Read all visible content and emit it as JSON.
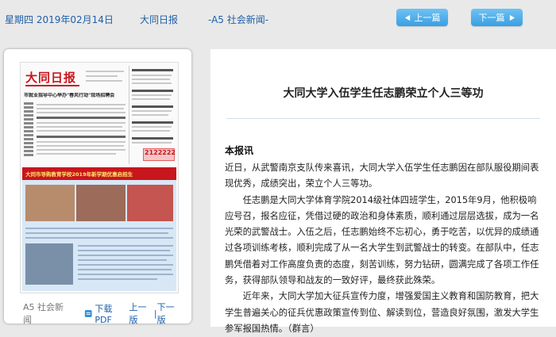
{
  "topbar": {
    "date": "星期四 2019年02月14日",
    "paper": "大同日报",
    "section": "-A5 社会新闻-",
    "prev_label": "上一篇",
    "next_label": "下一篇"
  },
  "thumbnail": {
    "masthead": "大同日报",
    "headline1": "市就业指导中心举办\"春风行动\"现场招聘会",
    "banner": "大同市导购教育学校2019年新学期优惠启招生",
    "red_number": "2122222"
  },
  "footer": {
    "section": "A5 社会新闻",
    "pdf_label": "下载PDF",
    "prev": "上一版",
    "next": "下一版",
    "separator": "|"
  },
  "article": {
    "title": "大同大学入伍学生任志鹏荣立个人三等功",
    "lead": "本报讯",
    "paragraphs": [
      "近日，从武警南京支队传来喜讯，大同大学入伍学生任志鹏因在部队服役期间表现优秀，成绩突出，荣立个人三等功。",
      "任志鹏是大同大学体育学院2014级社体四班学生，2015年9月，他积极响应号召，报名应征，凭借过硬的政治和身体素质，顺利通过层层选拔，成为一名光荣的武警战士。入伍之后，任志鹏始终不忘初心，勇于吃苦，以优异的成绩通过各项训练考核，顺利完成了从一名大学生到武警战士的转变。在部队中，任志鹏凭借着对工作高度负责的态度，刻苦训练，努力钻研，圆满完成了各项工作任务，获得部队领导和战友的一致好评，最终获此殊荣。",
      "近年来，大同大学加大征兵宣传力度，增强爱国主义教育和国防教育，把大学生普遍关心的征兵优惠政策宣传到位、解读到位，营造良好氛围，激发大学生参军报国热情。（群言）"
    ]
  },
  "colors": {
    "link_blue": "#1f5fa8",
    "button_blue": "#3a9fe3",
    "masthead_red": "#c8161d"
  }
}
